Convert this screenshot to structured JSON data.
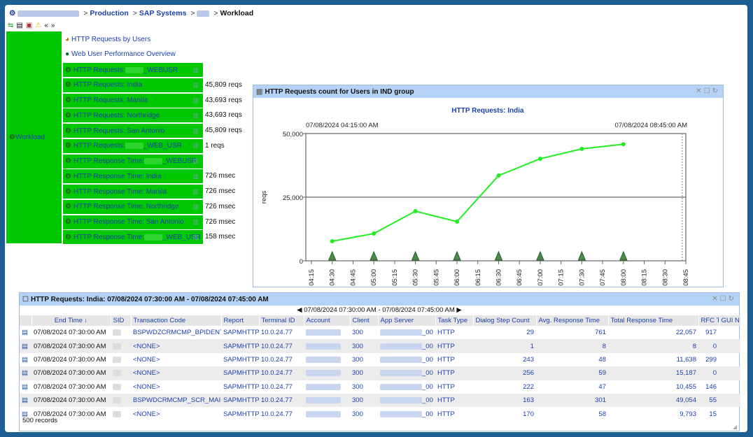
{
  "breadcrumb": {
    "items": [
      "Production",
      "SAP Systems"
    ],
    "current": "Workload"
  },
  "tree": {
    "root": "Workload",
    "links": [
      "HTTP Requests by Users",
      "Web User Performance Overview"
    ],
    "items": [
      {
        "label": "HTTP Requests: ",
        "suffix": "_WEBUSR",
        "value": ""
      },
      {
        "label": "HTTP Requests: India",
        "suffix": "",
        "value": "45,809 reqs"
      },
      {
        "label": "HTTP Requests: Manila",
        "suffix": "",
        "value": "43,693 reqs"
      },
      {
        "label": "HTTP Requests: Northridge",
        "suffix": "",
        "value": "43,693 reqs"
      },
      {
        "label": "HTTP Requests: San Antonio",
        "suffix": "",
        "value": "45,809 reqs"
      },
      {
        "label": "HTTP Requests: ",
        "suffix": "_WEB_USR",
        "value": "1 reqs"
      },
      {
        "label": "HTTP Response Time: ",
        "suffix": "_WEBUSR",
        "value": ""
      },
      {
        "label": "HTTP Response Time: India",
        "suffix": "",
        "value": "726 msec"
      },
      {
        "label": "HTTP Response Time: Manila",
        "suffix": "",
        "value": "726 msec"
      },
      {
        "label": "HTTP Response Time: Northridge",
        "suffix": "",
        "value": "726 msec"
      },
      {
        "label": "HTTP Response Time: San Antonio",
        "suffix": "",
        "value": "726 msec"
      },
      {
        "label": "HTTP Response Time: ",
        "suffix": "_WEB_USR",
        "value": "158 msec"
      }
    ]
  },
  "chart_panel": {
    "title": "HTTP Requests count for Users in IND group"
  },
  "chart_data": {
    "type": "line",
    "title": "HTTP Requests: India",
    "start_label": "07/08/2024 04:15:00 AM",
    "end_label": "07/08/2024 08:45:00 AM",
    "ylabel": "reqs",
    "ylim": [
      0,
      50000
    ],
    "yticks": [
      "0",
      "25,000",
      "50,000"
    ],
    "xticks": [
      "04:15",
      "04:30",
      "04:45",
      "05:00",
      "05:15",
      "05:30",
      "05:45",
      "06:00",
      "06:15",
      "06:30",
      "06:45",
      "07:00",
      "07:15",
      "07:30",
      "07:45",
      "08:00",
      "08:15",
      "08:30",
      "08:45"
    ],
    "grid": "horizontal at 25,000",
    "color": "#22ee22",
    "series": [
      {
        "x": [
          "04:30",
          "05:00",
          "05:30",
          "06:00",
          "06:30",
          "07:00",
          "07:30",
          "08:00"
        ],
        "values": [
          7700,
          10700,
          19500,
          15400,
          33500,
          40100,
          44000,
          45809
        ]
      }
    ]
  },
  "table_panel": {
    "title": "HTTP Requests: India: 07/08/2024 07:30:00 AM - 07/08/2024 07:45:00 AM",
    "range": "07/08/2024 07:30:00 AM - 07/08/2024 07:45:00 AM",
    "records": "500 records",
    "columns": [
      "End Time ↓",
      "SID",
      "Transaction Code",
      "Report",
      "Terminal ID",
      "Account",
      "Client",
      "App Server",
      "Task Type",
      "Dialog Step Count",
      "Avg. Response Time",
      "Total Response Time",
      "RFC Time",
      "GUI N"
    ],
    "rows": [
      [
        "07/08/2024 07:30:00 AM",
        "",
        "BSPWDZCRMCMP_BPIDENT",
        "SAPMHTTP",
        "10.0.24.77",
        "",
        "300",
        "_00",
        "HTTP",
        "29",
        "761",
        "22,057",
        "917"
      ],
      [
        "07/08/2024 07:30:00 AM",
        "",
        "<NONE>",
        "SAPMHTTP",
        "10.0.24.77",
        "",
        "300",
        "_00",
        "HTTP",
        "1",
        "8",
        "8",
        "0"
      ],
      [
        "07/08/2024 07:30:00 AM",
        "",
        "<NONE>",
        "SAPMHTTP",
        "10.0.24.77",
        "",
        "300",
        "_00",
        "HTTP",
        "243",
        "48",
        "11,638",
        "299"
      ],
      [
        "07/08/2024 07:30:00 AM",
        "",
        "<NONE>",
        "SAPMHTTP",
        "10.0.24.77",
        "",
        "300",
        "_00",
        "HTTP",
        "256",
        "59",
        "15,187",
        "0"
      ],
      [
        "07/08/2024 07:30:00 AM",
        "",
        "<NONE>",
        "SAPMHTTP",
        "10.0.24.77",
        "",
        "300",
        "_00",
        "HTTP",
        "222",
        "47",
        "10,455",
        "146"
      ],
      [
        "07/08/2024 07:30:00 AM",
        "",
        "BSPWDCRMCMP_SCR_MAIN",
        "SAPMHTTP",
        "10.0.24.77",
        "",
        "300",
        "_00",
        "HTTP",
        "163",
        "301",
        "49,054",
        "55"
      ],
      [
        "07/08/2024 07:30:00 AM",
        "",
        "<NONE>",
        "SAPMHTTP",
        "10.0.24.77",
        "",
        "300",
        "_00",
        "HTTP",
        "170",
        "58",
        "9,793",
        "15"
      ]
    ]
  }
}
